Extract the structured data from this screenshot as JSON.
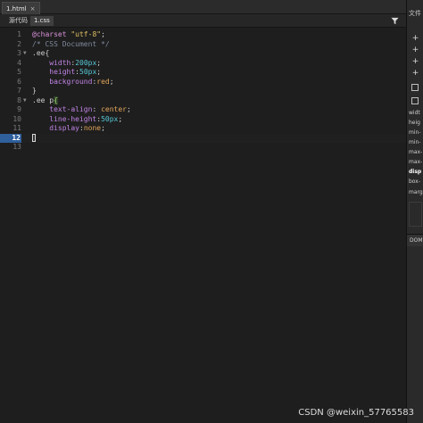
{
  "document_tab": {
    "label": "1.html",
    "close": "×"
  },
  "file_bar": {
    "source_label": "源代码",
    "css_label": "1.css"
  },
  "editor": {
    "active_line": 12,
    "lines": [
      {
        "num": "1",
        "fold": "",
        "tokens": [
          [
            "kw-at",
            "@charset "
          ],
          [
            "str",
            "\"utf-8\""
          ],
          [
            "punct",
            ";"
          ]
        ]
      },
      {
        "num": "2",
        "fold": "",
        "tokens": [
          [
            "comment",
            "/* CSS Document */"
          ]
        ]
      },
      {
        "num": "3",
        "fold": "▼",
        "tokens": [
          [
            "sel",
            ".ee{"
          ]
        ]
      },
      {
        "num": "4",
        "fold": "",
        "tokens": [
          [
            "sel",
            "    "
          ],
          [
            "prop",
            "width"
          ],
          [
            "punct",
            ":"
          ],
          [
            "num",
            "200px"
          ],
          [
            "punct",
            ";"
          ]
        ]
      },
      {
        "num": "5",
        "fold": "",
        "tokens": [
          [
            "sel",
            "    "
          ],
          [
            "prop",
            "height"
          ],
          [
            "punct",
            ":"
          ],
          [
            "num",
            "50px"
          ],
          [
            "punct",
            ";"
          ]
        ]
      },
      {
        "num": "6",
        "fold": "",
        "tokens": [
          [
            "sel",
            "    "
          ],
          [
            "prop",
            "background"
          ],
          [
            "punct",
            ":"
          ],
          [
            "val",
            "red"
          ],
          [
            "punct",
            ";"
          ]
        ]
      },
      {
        "num": "7",
        "fold": "",
        "tokens": [
          [
            "sel",
            "}"
          ]
        ]
      },
      {
        "num": "8",
        "fold": "▼",
        "tokens": [
          [
            "sel",
            ".ee p"
          ],
          [
            "bracket-hl",
            "{"
          ]
        ]
      },
      {
        "num": "9",
        "fold": "",
        "tokens": [
          [
            "sel",
            "    "
          ],
          [
            "prop",
            "text-align"
          ],
          [
            "punct",
            ": "
          ],
          [
            "val",
            "center"
          ],
          [
            "punct",
            ";"
          ]
        ]
      },
      {
        "num": "10",
        "fold": "",
        "tokens": [
          [
            "sel",
            "    "
          ],
          [
            "prop",
            "line-height"
          ],
          [
            "punct",
            ":"
          ],
          [
            "num",
            "50px"
          ],
          [
            "punct",
            ";"
          ]
        ]
      },
      {
        "num": "11",
        "fold": "",
        "tokens": [
          [
            "sel",
            "    "
          ],
          [
            "prop",
            "display"
          ],
          [
            "punct",
            ":"
          ],
          [
            "val",
            "none"
          ],
          [
            "punct",
            ";"
          ]
        ]
      },
      {
        "num": "12",
        "fold": "",
        "tokens": [
          [
            "caret",
            ""
          ]
        ]
      },
      {
        "num": "13",
        "fold": "",
        "tokens": []
      }
    ]
  },
  "right_panel": {
    "title": "文件",
    "buttons": [
      "+",
      "+",
      "+",
      "+"
    ],
    "props": [
      "widt",
      "heig",
      "min-",
      "min-",
      "max-",
      "max-",
      "disp",
      "box-",
      "marg"
    ],
    "bold_prop": "disp",
    "section_label": "DOM"
  },
  "watermark": "CSDN @weixin_57765583"
}
